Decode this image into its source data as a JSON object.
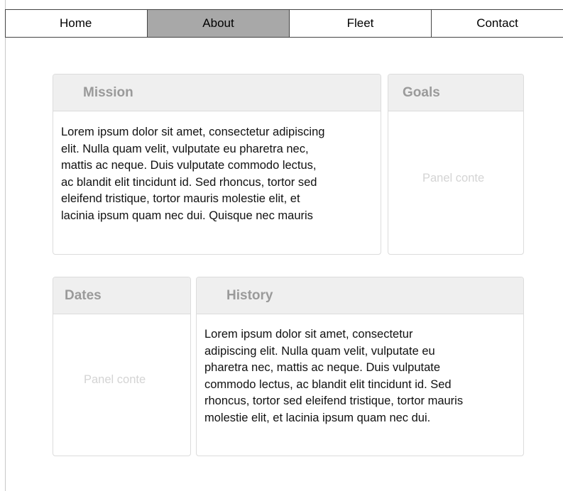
{
  "nav": {
    "items": [
      {
        "label": "Home",
        "active": false
      },
      {
        "label": "About",
        "active": true
      },
      {
        "label": "Fleet",
        "active": false
      },
      {
        "label": "Contact",
        "active": false
      }
    ]
  },
  "panels": {
    "mission": {
      "title": "Mission",
      "lines": [
        "Lorem ipsum dolor sit amet, consectetur adipiscing",
        "elit. Nulla quam velit, vulputate eu pharetra nec,",
        "mattis ac neque. Duis vulputate commodo lectus,",
        "ac blandit elit tincidunt id. Sed rhoncus, tortor sed",
        "eleifend tristique, tortor mauris molestie elit, et",
        "lacinia ipsum quam nec dui. Quisque nec mauris"
      ]
    },
    "goals": {
      "title": "Goals",
      "placeholder": "Panel conte"
    },
    "dates": {
      "title": "Dates",
      "placeholder": "Panel conte"
    },
    "history": {
      "title": "History",
      "lines": [
        "Lorem ipsum dolor sit amet, consectetur",
        "adipiscing elit. Nulla quam velit, vulputate eu",
        "pharetra nec, mattis ac neque. Duis vulputate",
        "commodo lectus, ac blandit elit tincidunt id. Sed",
        "rhoncus, tortor sed eleifend tristique, tortor mauris",
        "molestie elit, et lacinia ipsum quam nec dui."
      ]
    }
  },
  "colors": {
    "nav_active": "#a8a8a8",
    "panel_header_bg": "#efefef",
    "panel_title": "#9a9a9a",
    "placeholder_text": "#d4d4d4",
    "border": "#dcdcdc"
  }
}
